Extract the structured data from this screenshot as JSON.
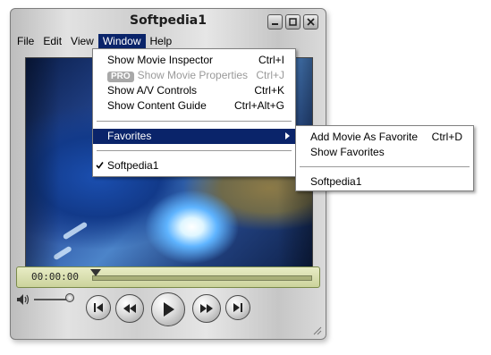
{
  "window": {
    "title": "Softpedia1"
  },
  "menubar": {
    "items": [
      "File",
      "Edit",
      "View",
      "Window",
      "Help"
    ]
  },
  "window_menu": {
    "items": [
      {
        "label": "Show Movie Inspector",
        "shortcut": "Ctrl+I"
      },
      {
        "badge": "PRO",
        "label": "Show Movie Properties",
        "shortcut": "Ctrl+J",
        "disabled": true
      },
      {
        "label": "Show A/V Controls",
        "shortcut": "Ctrl+K"
      },
      {
        "label": "Show Content Guide",
        "shortcut": "Ctrl+Alt+G"
      },
      {
        "label": "Favorites",
        "submenu": true
      },
      {
        "label": "Softpedia1",
        "checked": true
      }
    ]
  },
  "favorites_menu": {
    "items": [
      {
        "label": "Add Movie As Favorite",
        "shortcut": "Ctrl+D"
      },
      {
        "label": "Show Favorites"
      },
      {
        "label": "Softpedia1"
      }
    ]
  },
  "player": {
    "timecode": "00:00:00",
    "progress": 0,
    "volume": 0.8
  },
  "colors": {
    "menu_selection": "#0a246a",
    "lcd_background": "#d9dfae"
  },
  "icons": [
    "minimize-icon",
    "maximize-icon",
    "close-icon",
    "speaker-icon",
    "rewind-to-start-icon",
    "rewind-icon",
    "play-icon",
    "fast-forward-icon",
    "skip-to-end-icon",
    "submenu-arrow-icon",
    "checkmark-icon",
    "resize-grip-icon"
  ]
}
